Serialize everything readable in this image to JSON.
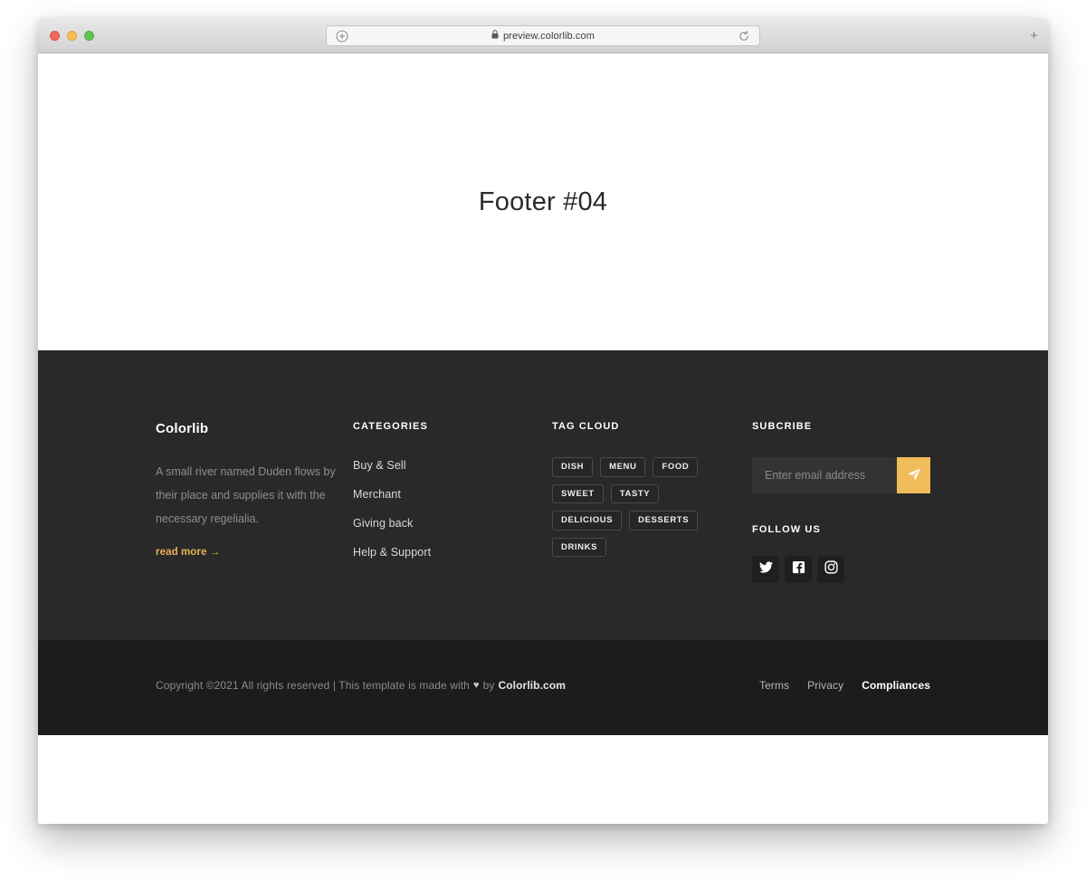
{
  "browser": {
    "traffic_lights": [
      "close",
      "minimize",
      "zoom"
    ],
    "url": "preview.colorlib.com",
    "left_icon": "plus-circle-icon",
    "lock_icon": "lock-icon",
    "reload_icon": "reload-icon",
    "new_tab_label": "+"
  },
  "hero": {
    "title": "Footer #04"
  },
  "footer": {
    "brand": {
      "title": "Colorlib",
      "text": "A small river named Duden flows by their place and supplies it with the necessary regelialia.",
      "read_more": "read more →"
    },
    "categories": {
      "heading": "CATEGORIES",
      "items": [
        {
          "label": "Buy & Sell"
        },
        {
          "label": "Merchant"
        },
        {
          "label": "Giving back"
        },
        {
          "label": "Help & Support"
        }
      ]
    },
    "tag_cloud": {
      "heading": "TAG CLOUD",
      "tags": [
        {
          "label": "DISH"
        },
        {
          "label": "MENU"
        },
        {
          "label": "FOOD"
        },
        {
          "label": "SWEET"
        },
        {
          "label": "TASTY"
        },
        {
          "label": "DELICIOUS"
        },
        {
          "label": "DESSERTS"
        },
        {
          "label": "DRINKS"
        }
      ]
    },
    "subscribe": {
      "heading": "SUBCRIBE",
      "placeholder": "Enter email address",
      "value": "",
      "button_icon": "send-icon",
      "button_color": "#f0bd5a"
    },
    "follow": {
      "heading": "FOLLOW US",
      "networks": [
        {
          "name": "twitter"
        },
        {
          "name": "facebook"
        },
        {
          "name": "instagram"
        }
      ]
    },
    "bottom": {
      "copyright_prefix": "Copyright ©2021 All rights reserved | This template is made with",
      "heart": "♥",
      "copyright_by": "by",
      "brand_link": "Colorlib.com",
      "links": [
        {
          "label": "Terms"
        },
        {
          "label": "Privacy"
        },
        {
          "label": "Compliances"
        }
      ]
    },
    "colors": {
      "main_bg": "#292929",
      "bottom_bg": "#1c1c1c",
      "accent": "#e8b352"
    }
  }
}
